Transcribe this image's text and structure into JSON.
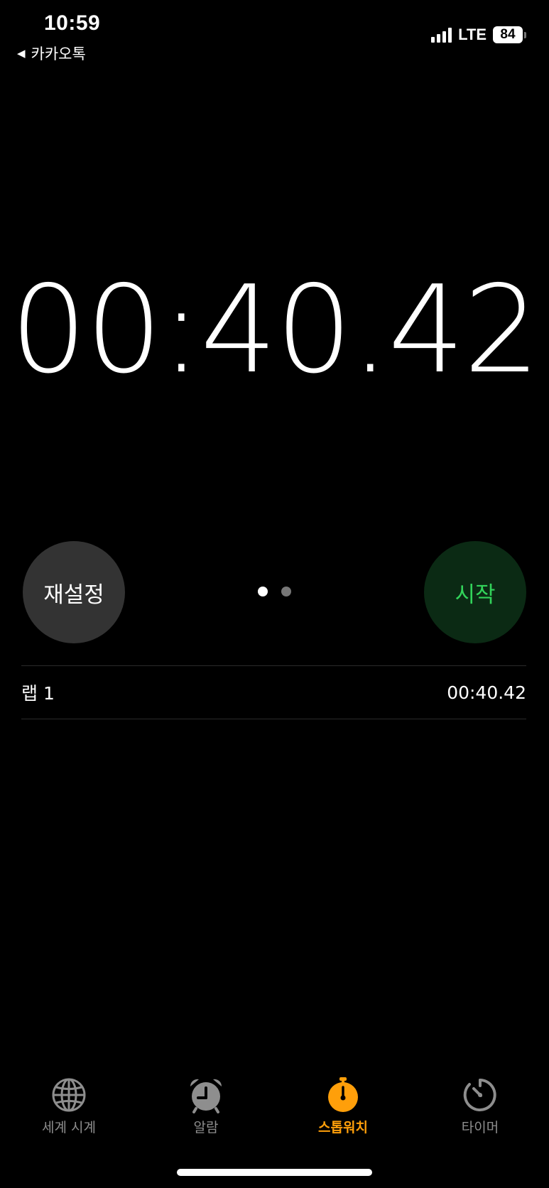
{
  "status_bar": {
    "time": "10:59",
    "back_app": "카카오톡",
    "network": "LTE",
    "battery": "84"
  },
  "stopwatch": {
    "display": "00:40.42",
    "reset_label": "재설정",
    "start_label": "시작",
    "page_count": 2,
    "active_page": 1
  },
  "laps": [
    {
      "label": "랩 1",
      "time": "00:40.42"
    }
  ],
  "tab_bar": {
    "items": [
      {
        "label": "세계 시계",
        "icon": "globe-icon"
      },
      {
        "label": "알람",
        "icon": "alarm-clock-icon"
      },
      {
        "label": "스톱워치",
        "icon": "stopwatch-icon",
        "active": true
      },
      {
        "label": "타이머",
        "icon": "timer-icon"
      }
    ]
  },
  "colors": {
    "background": "#000000",
    "accent": "#ff9f0a",
    "start_green": "#32d35a",
    "start_bg": "#0b2a14",
    "reset_bg": "#333333",
    "inactive_tab": "#8e8e8e"
  }
}
